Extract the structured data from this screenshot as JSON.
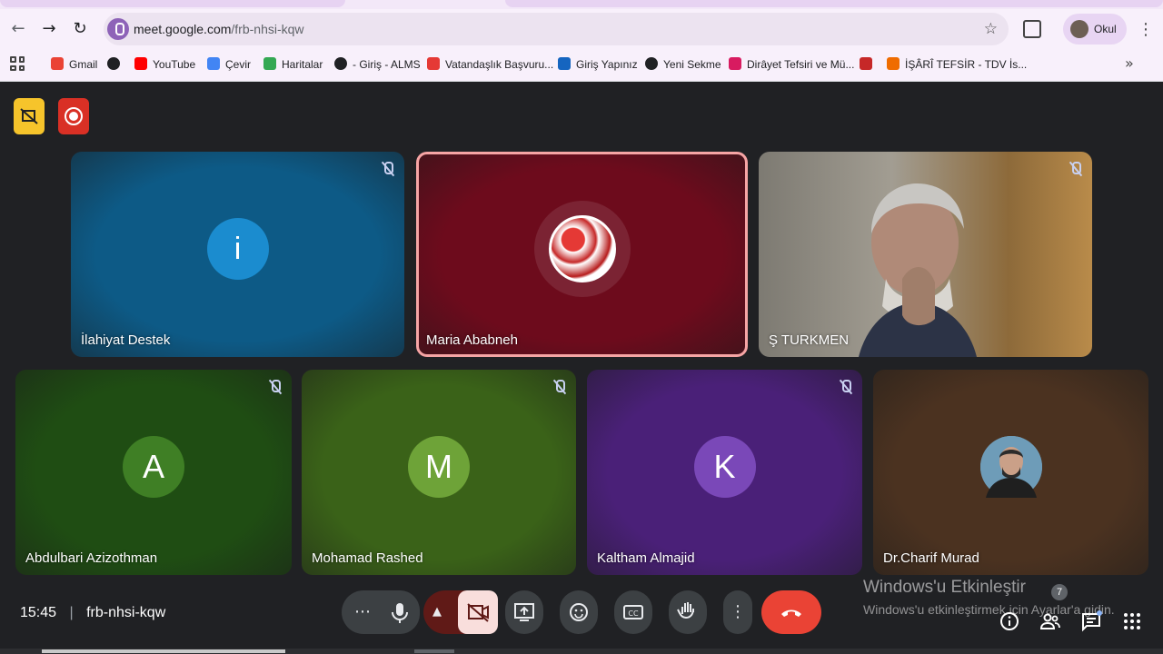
{
  "browser": {
    "url_domain": "meet.google.com",
    "url_path": "/frb-nhsi-kqw",
    "profile_name": "Okul",
    "bookmarks": [
      {
        "label": "Gmail",
        "color": "#ea4335"
      },
      {
        "label": "",
        "color": "#202124"
      },
      {
        "label": "YouTube",
        "color": "#ff0000"
      },
      {
        "label": "Çevir",
        "color": "#4285f4"
      },
      {
        "label": "Haritalar",
        "color": "#34a853"
      },
      {
        "label": "- Giriş - ALMS",
        "color": "#202124"
      },
      {
        "label": "Vatandaşlık Başvuru...",
        "color": "#e53935"
      },
      {
        "label": "Giriş Yapınız",
        "color": "#1565c0"
      },
      {
        "label": "Yeni Sekme",
        "color": "#202124"
      },
      {
        "label": "Dirâyet Tefsiri ve Mü...",
        "color": "#d81b60"
      },
      {
        "label": "",
        "color": "#c62828"
      },
      {
        "label": "İŞÂRÎ TEFSİR - TDV İs...",
        "color": "#ef6c00"
      }
    ]
  },
  "participants": [
    {
      "name": "İlahiyat Destek",
      "initial": "i",
      "bg": "#0d5a86",
      "avatar_color": "#1b8ccf",
      "muted": true
    },
    {
      "name": "Maria Ababneh",
      "initial": "",
      "bg": "#6d0b1c",
      "avatar_color": "#c2185b",
      "muted": false
    },
    {
      "name": "Ş TURKMEN",
      "initial": "",
      "bg": "#8a8579",
      "avatar_color": "",
      "muted": true
    },
    {
      "name": "Abdulbari Azizothman",
      "initial": "A",
      "bg": "#1f4d13",
      "avatar_color": "#3f7f25",
      "muted": true
    },
    {
      "name": "Mohamad Rashed",
      "initial": "M",
      "bg": "#3a6218",
      "avatar_color": "#6ea338",
      "muted": true
    },
    {
      "name": "Kaltham Almajid",
      "initial": "K",
      "bg": "#4a2078",
      "avatar_color": "#7a48b8",
      "muted": true
    },
    {
      "name": "Dr.Charif Murad",
      "initial": "",
      "bg": "#4b3220",
      "avatar_color": "#8aa0b0",
      "muted": false
    }
  ],
  "meeting": {
    "time": "15:45",
    "code": "frb-nhsi-kqw",
    "participant_count": "7"
  },
  "watermark": {
    "line1": "Windows'u Etkinleştir",
    "line2": "Windows'u etkinleştirmek için Ayarlar'a gidin."
  },
  "icons": {
    "record": "record-icon",
    "video_off": "video-off-icon"
  }
}
